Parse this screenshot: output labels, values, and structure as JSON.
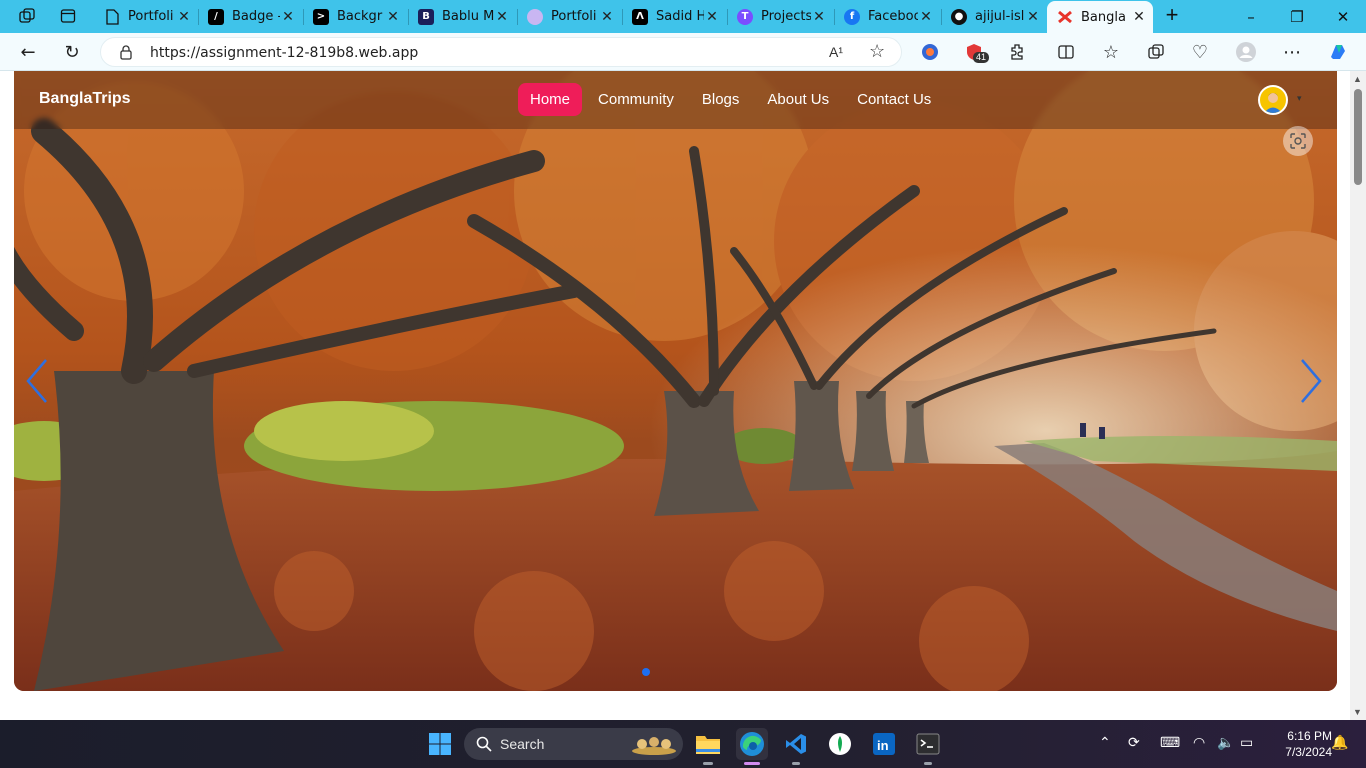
{
  "browser": {
    "tabs": [
      {
        "title": "Portfoli",
        "icon": "page-icon"
      },
      {
        "title": "Badge -",
        "icon": "badge-site-icon"
      },
      {
        "title": "Backgr",
        "icon": "terminal-icon"
      },
      {
        "title": "Bablu M",
        "icon": "bootstrap-icon"
      },
      {
        "title": "Portfoli",
        "icon": "avatar-icon"
      },
      {
        "title": "Sadid H",
        "icon": "logo-icon"
      },
      {
        "title": "Projects",
        "icon": "t-logo-icon"
      },
      {
        "title": "Faceboo",
        "icon": "facebook-icon"
      },
      {
        "title": "ajijul-isl",
        "icon": "github-icon"
      },
      {
        "title": "Bangla",
        "icon": "bangla-trips-icon"
      }
    ],
    "url": "https://assignment-12-819b8.web.app",
    "extension_badge": "41",
    "read_aloud_label": "A¹"
  },
  "site": {
    "brand": "BanglaTrips",
    "nav": [
      {
        "label": "Home",
        "active": true
      },
      {
        "label": "Community",
        "active": false
      },
      {
        "label": "Blogs",
        "active": false
      },
      {
        "label": "About Us",
        "active": false
      },
      {
        "label": "Contact Us",
        "active": false
      }
    ],
    "carousel": {
      "slides": 1,
      "active_index": 0
    }
  },
  "taskbar": {
    "search_label": "Search",
    "time": "6:16 PM",
    "date": "7/3/2024"
  },
  "colors": {
    "tabstrip": "#3fc3ea",
    "nav_active": "#ef1d59",
    "carousel_dot_active": "#1d6ff2"
  }
}
